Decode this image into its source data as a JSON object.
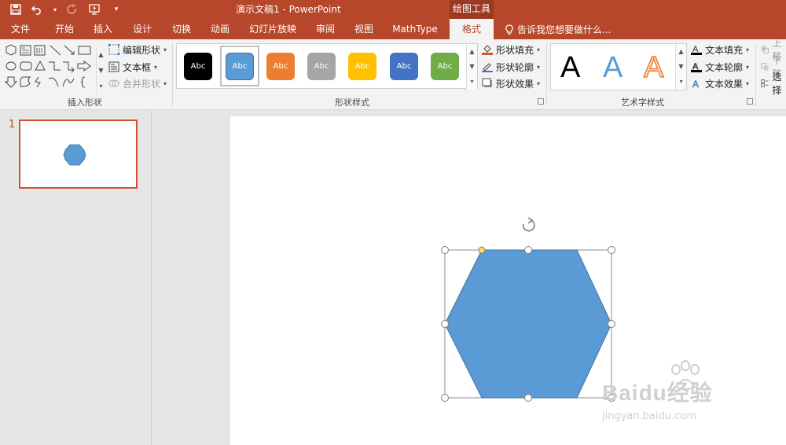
{
  "app": {
    "window_title": "演示文稿1 - PowerPoint",
    "contextual_tab_group": "绘图工具"
  },
  "tabs": [
    {
      "label": "文件"
    },
    {
      "label": "开始"
    },
    {
      "label": "插入"
    },
    {
      "label": "设计"
    },
    {
      "label": "切换"
    },
    {
      "label": "动画"
    },
    {
      "label": "幻灯片放映"
    },
    {
      "label": "审阅"
    },
    {
      "label": "视图"
    },
    {
      "label": "MathType"
    },
    {
      "label": "格式",
      "active": true
    }
  ],
  "tell_me": "告诉我您想要做什么...",
  "groups": {
    "insert_shapes": {
      "label": "插入形状",
      "edit_shape": "编辑形状",
      "text_box": "文本框",
      "merge_shapes": "合并形状"
    },
    "shape_styles": {
      "label": "形状样式",
      "swatch_text": "Abc",
      "swatches": [
        "#000000",
        "#5b9bd5",
        "#ed7d31",
        "#a5a5a5",
        "#ffc000",
        "#4472c4",
        "#70ad47"
      ],
      "shape_fill": "形状填充",
      "shape_outline": "形状轮廓",
      "shape_effects": "形状效果"
    },
    "wordart_styles": {
      "label": "艺术字样式",
      "samples": [
        "A",
        "A",
        "A"
      ],
      "text_fill": "文本填充",
      "text_outline": "文本轮廓",
      "text_effects": "文本效果"
    },
    "arrange": {
      "up": "上移",
      "down": "下移",
      "select": "选择"
    }
  },
  "slide_pane": {
    "slide_number": "1"
  },
  "canvas": {
    "shape": "hexagon",
    "fill": "#5b9bd5",
    "outline": "#41719c"
  },
  "watermark": {
    "main": "Baidu经验",
    "sub": "jingyan.baidu.com"
  },
  "colors": {
    "accent": "#b7472a",
    "contextual": "#9b3a22",
    "selected_thumb_border": "#d35230"
  }
}
